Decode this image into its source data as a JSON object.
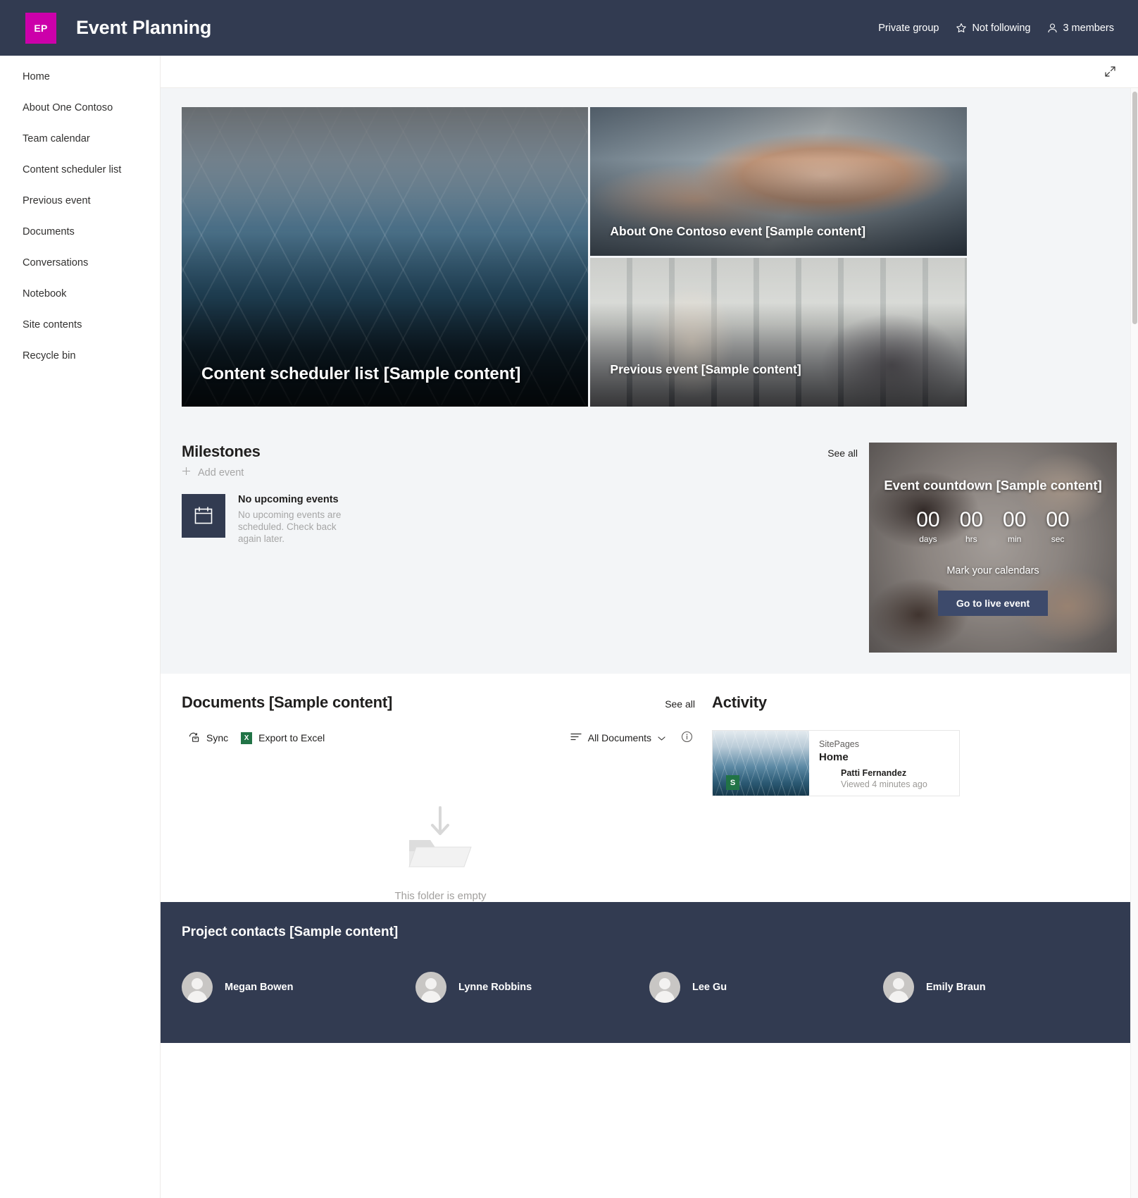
{
  "header": {
    "logo_initials": "EP",
    "logo_color": "#cc00aa",
    "title": "Event Planning",
    "privacy": "Private group",
    "follow": "Not following",
    "members": "3 members"
  },
  "sidebar": {
    "items": [
      {
        "label": "Home"
      },
      {
        "label": "About One Contoso"
      },
      {
        "label": "Team calendar"
      },
      {
        "label": "Content scheduler list"
      },
      {
        "label": "Previous event"
      },
      {
        "label": "Documents"
      },
      {
        "label": "Conversations"
      },
      {
        "label": "Notebook"
      },
      {
        "label": "Site contents"
      },
      {
        "label": "Recycle bin"
      }
    ]
  },
  "hero": {
    "tiles": [
      {
        "caption": "Content scheduler list [Sample content]"
      },
      {
        "caption": "About One Contoso event [Sample content]"
      },
      {
        "caption": "Previous event [Sample content]"
      }
    ]
  },
  "milestones": {
    "title": "Milestones",
    "see_all": "See all",
    "add_event": "Add event",
    "empty_title": "No upcoming events",
    "empty_desc": "No upcoming events are scheduled. Check back again later."
  },
  "countdown": {
    "title": "Event countdown [Sample content]",
    "units": [
      {
        "value": "00",
        "label": "days"
      },
      {
        "value": "00",
        "label": "hrs"
      },
      {
        "value": "00",
        "label": "min"
      },
      {
        "value": "00",
        "label": "sec"
      }
    ],
    "mark": "Mark your calendars",
    "button": "Go to live event",
    "button_color": "#3d4a6b"
  },
  "documents": {
    "title": "Documents [Sample content]",
    "see_all": "See all",
    "sync": "Sync",
    "export": "Export to Excel",
    "excel_glyph": "X",
    "view": "All Documents",
    "empty": "This folder is empty"
  },
  "activity": {
    "title": "Activity",
    "card": {
      "site": "SitePages",
      "page": "Home",
      "user": "Patti Fernandez",
      "when": "Viewed 4 minutes ago",
      "badge": "S"
    }
  },
  "contacts": {
    "title": "Project contacts [Sample content]",
    "people": [
      {
        "name": "Megan Bowen"
      },
      {
        "name": "Lynne Robbins"
      },
      {
        "name": "Lee Gu"
      },
      {
        "name": "Emily Braun"
      }
    ]
  }
}
